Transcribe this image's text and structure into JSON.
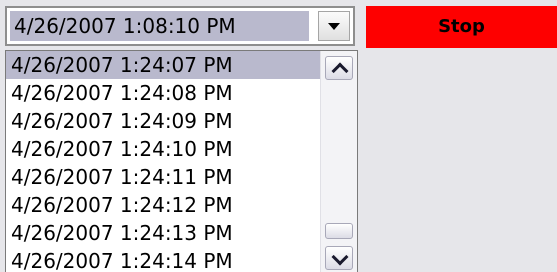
{
  "combo": {
    "value": "4/26/2007 1:08:10 PM",
    "dropdown_icon": "triangle-down-icon"
  },
  "stop_button": {
    "label": "Stop",
    "color": "#fe0000"
  },
  "list": {
    "items": [
      "4/26/2007 1:24:07 PM",
      "4/26/2007 1:24:08 PM",
      "4/26/2007 1:24:09 PM",
      "4/26/2007 1:24:10 PM",
      "4/26/2007 1:24:11 PM",
      "4/26/2007 1:24:12 PM",
      "4/26/2007 1:24:13 PM",
      "4/26/2007 1:24:14 PM"
    ],
    "selected_index": 0,
    "selection_color": "#b9b9cd"
  },
  "scrollbar": {
    "up_icon": "chevron-up-icon",
    "down_icon": "chevron-down-icon"
  }
}
